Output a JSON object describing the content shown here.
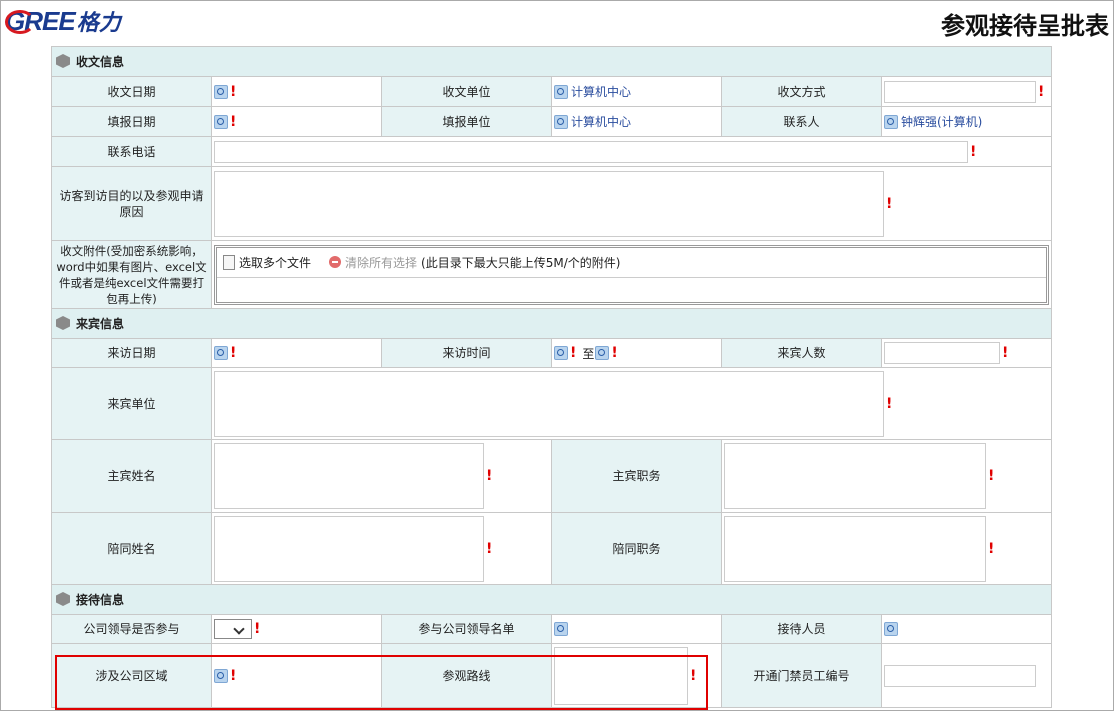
{
  "header": {
    "logo_text": "GREE",
    "logo_cn": "格力",
    "title": "参观接待呈批表"
  },
  "sections": {
    "receipt": "收文信息",
    "visitor": "来宾信息",
    "reception": "接待信息"
  },
  "receipt": {
    "date_label": "收文日期",
    "unit_label": "收文单位",
    "unit_value": "计算机中心",
    "method_label": "收文方式",
    "fill_date_label": "填报日期",
    "fill_unit_label": "填报单位",
    "fill_unit_value": "计算机中心",
    "contact_label": "联系人",
    "contact_value": "钟辉强(计算机)",
    "phone_label": "联系电话",
    "purpose_label": "访客到访目的以及参观申请原因",
    "attach_label": "收文附件(受加密系统影响，word中如果有图片、excel文件或者是纯excel文件需要打包再上传)",
    "select_files": "选取多个文件",
    "clear_all": "清除所有选择",
    "upload_hint": "(此目录下最大只能上传5M/个的附件)"
  },
  "visitor": {
    "date_label": "来访日期",
    "time_label": "来访时间",
    "time_to": "至",
    "count_label": "来宾人数",
    "unit_label": "来宾单位",
    "guest_name_label": "主宾姓名",
    "guest_title_label": "主宾职务",
    "escort_name_label": "陪同姓名",
    "escort_title_label": "陪同职务"
  },
  "reception": {
    "leader_join_label": "公司领导是否参与",
    "leader_list_label": "参与公司领导名单",
    "staff_label": "接待人员",
    "area_label": "涉及公司区域",
    "route_label": "参观路线",
    "badge_label": "开通门禁员工编号"
  },
  "required_mark": "!"
}
